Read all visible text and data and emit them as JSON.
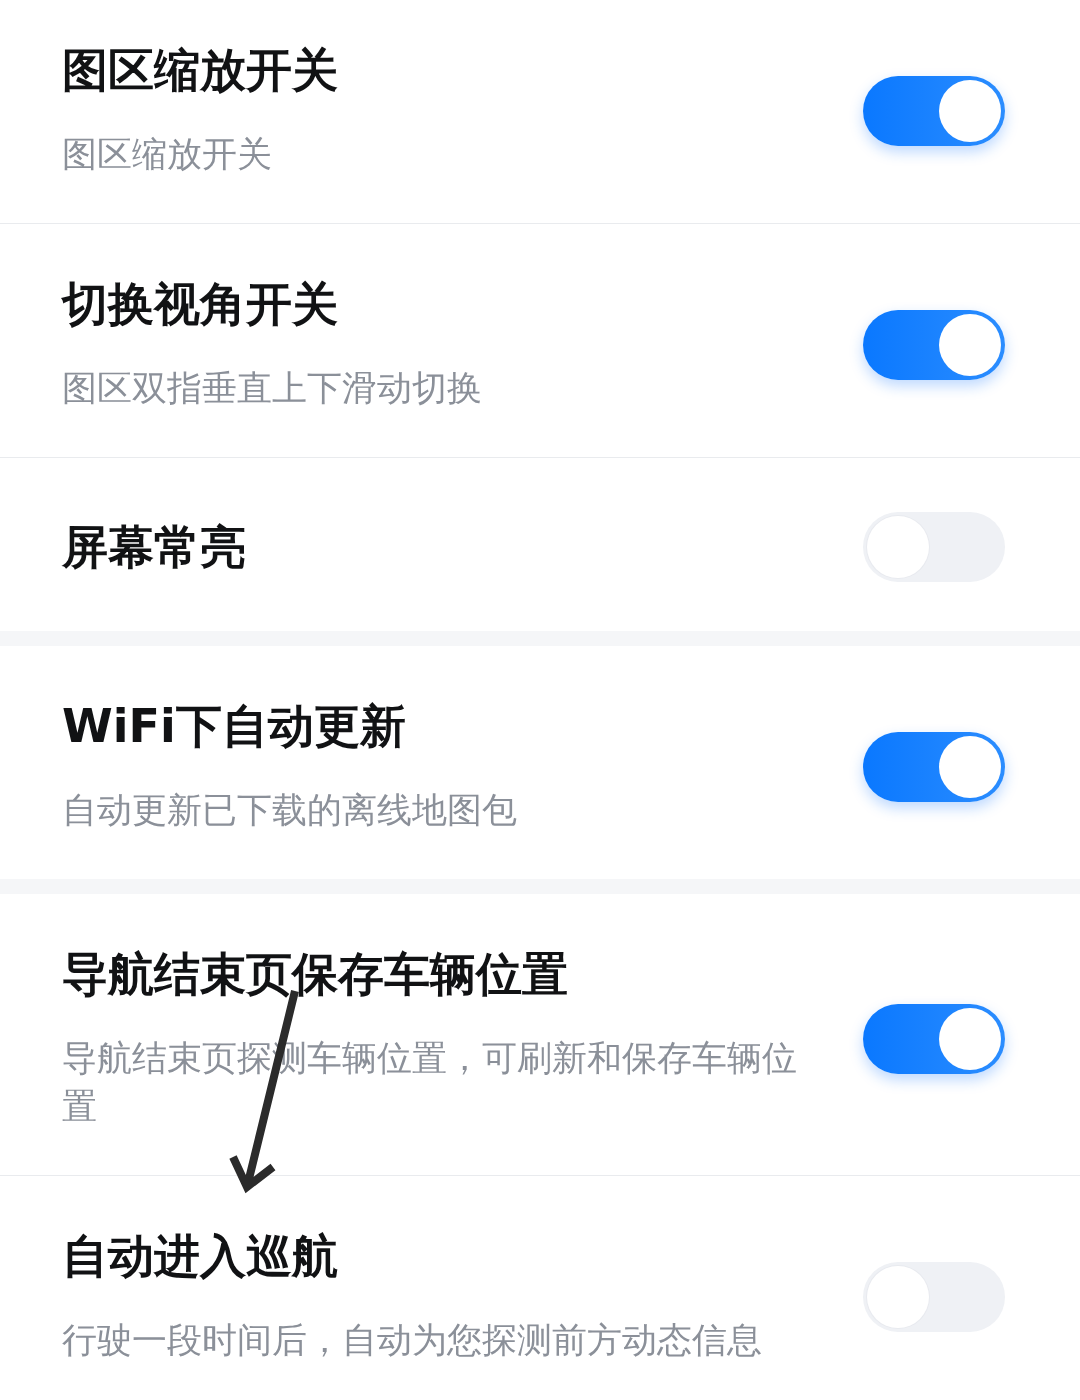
{
  "groups": [
    {
      "items": [
        {
          "title": "图区缩放开关",
          "subtitle": "图区缩放开关",
          "on": true
        },
        {
          "title": "切换视角开关",
          "subtitle": "图区双指垂直上下滑动切换",
          "on": true
        },
        {
          "title": "屏幕常亮",
          "on": false
        }
      ]
    },
    {
      "items": [
        {
          "title": "WiFi下自动更新",
          "subtitle": "自动更新已下载的离线地图包",
          "on": true
        }
      ]
    },
    {
      "items": [
        {
          "title": "导航结束页保存车辆位置",
          "subtitle": "导航结束页探测车辆位置，可刷新和保存车辆位置",
          "on": true
        },
        {
          "title": "自动进入巡航",
          "subtitle": "行驶一段时间后，自动为您探测前方动态信息",
          "on": false
        }
      ]
    }
  ],
  "annotations": [
    {
      "kind": "arrow"
    }
  ]
}
